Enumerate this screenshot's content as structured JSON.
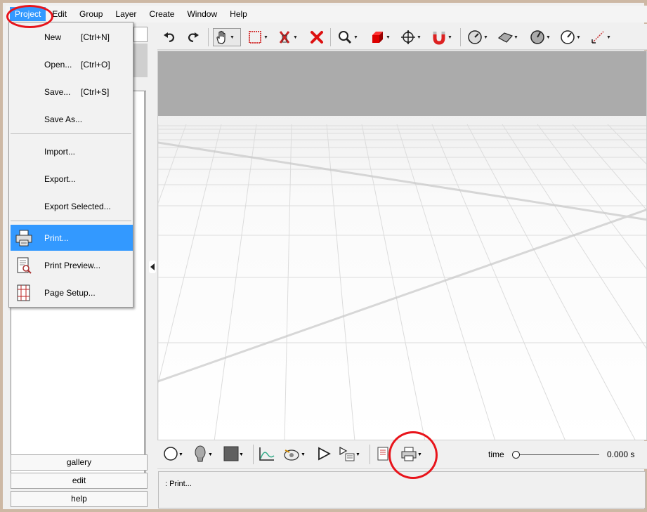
{
  "menubar": {
    "items": [
      "Project",
      "Edit",
      "Group",
      "Layer",
      "Create",
      "Window",
      "Help"
    ]
  },
  "project_menu": {
    "items": [
      {
        "label": "New",
        "shortcut": "[Ctrl+N]"
      },
      {
        "label": "Open...",
        "shortcut": "[Ctrl+O]"
      },
      {
        "label": "Save...",
        "shortcut": "[Ctrl+S]"
      },
      {
        "label": "Save As...",
        "shortcut": ""
      },
      {
        "label": "Import...",
        "shortcut": ""
      },
      {
        "label": "Export...",
        "shortcut": ""
      },
      {
        "label": "Export Selected...",
        "shortcut": ""
      },
      {
        "label": "Print...",
        "shortcut": "",
        "icon": "printer-icon",
        "highlighted": true
      },
      {
        "label": "Print Preview...",
        "shortcut": "",
        "icon": "print-preview-icon"
      },
      {
        "label": "Page Setup...",
        "shortcut": "",
        "icon": "page-setup-icon"
      }
    ]
  },
  "toolbar": {
    "icons": [
      "undo-icon",
      "redo-icon",
      "pan-hand-icon",
      "selection-rect-icon",
      "delete-x-icon",
      "remove-red-x-icon",
      "zoom-icon",
      "red-cube-icon",
      "move-crosshair-icon",
      "magnet-icon",
      "gauge-icon",
      "surface-icon",
      "dial-icon",
      "clock-dial-icon",
      "measure-icon"
    ]
  },
  "left_panel": {
    "buttons": [
      "gallery",
      "edit",
      "help"
    ]
  },
  "bottombar": {
    "icons": [
      "circle-icon",
      "head-icon",
      "color-square-icon",
      "curve-icon",
      "camera-icon",
      "play-icon",
      "play-list-icon",
      "document-icon",
      "printer-icon"
    ],
    "time_label": "time",
    "time_value": "0.000 s",
    "time_fraction": 0
  },
  "status": {
    "text": ": Print..."
  },
  "colors": {
    "menu_highlight": "#3399ff",
    "annotation_red": "#e8141b",
    "sky": "#ababab"
  }
}
